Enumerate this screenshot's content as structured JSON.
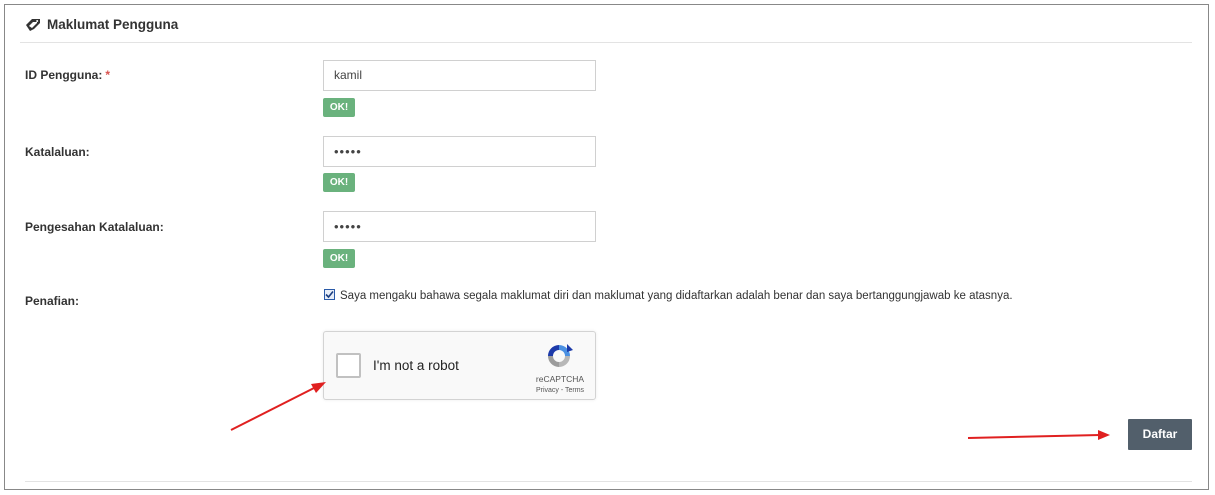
{
  "panel": {
    "title": "Maklumat Pengguna",
    "title_icon": "ticket-tag-icon"
  },
  "fields": {
    "user_id": {
      "label": "ID Pengguna:",
      "required_mark": "*",
      "value": "kamil",
      "status": "OK!"
    },
    "password": {
      "label": "Katalaluan:",
      "value": "•••••",
      "status": "OK!"
    },
    "confirm_password": {
      "label": "Pengesahan Katalaluan:",
      "value": "•••••",
      "status": "OK!"
    }
  },
  "disclaimer": {
    "label": "Penafian:",
    "checked": true,
    "text": "Saya mengaku bahawa segala maklumat diri dan maklumat yang didaftarkan adalah benar dan saya bertanggungjawab ke atasnya."
  },
  "captcha": {
    "label": "I'm not a robot",
    "brand": "reCAPTCHA",
    "terms": "Privacy - Terms"
  },
  "submit": {
    "label": "Daftar"
  },
  "colors": {
    "ok_badge": "#6ab27d",
    "submit_button": "#525f6b",
    "required": "#d9534f",
    "annotation_arrow": "#e02020"
  }
}
